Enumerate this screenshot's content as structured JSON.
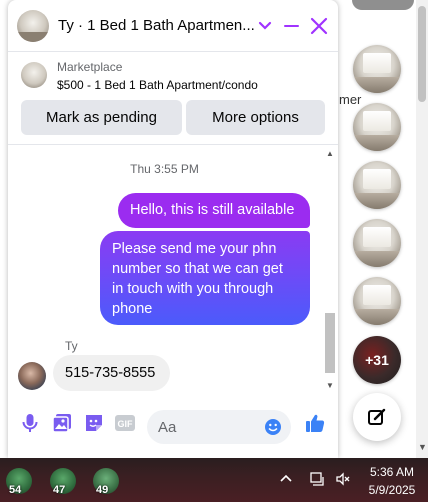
{
  "background": {
    "partial_text": "mer"
  },
  "chat_heads": {
    "more_count": "+31"
  },
  "chat": {
    "title": "Ty · 1 Bed 1 Bath Apartmen...",
    "marketplace": {
      "label": "Marketplace",
      "listing": "$500 - 1 Bed 1 Bath Apartment/condo",
      "pending_button": "Mark as pending",
      "more_button": "More options"
    },
    "thread": {
      "timestamp": "Thu 3:55 PM",
      "messages": [
        {
          "from": "me",
          "text": "Hello, this is still available"
        },
        {
          "from": "me",
          "text": "Please send me your phn number so that we can get in touch with you through phone"
        },
        {
          "from": "Ty",
          "text": "515-735-8555"
        }
      ],
      "sender_name": "Ty"
    },
    "composer": {
      "placeholder": "Aa"
    },
    "colors": {
      "accent": "#a033ff",
      "bubble_start": "#8a3bf3",
      "bubble_end": "#4b5bfb"
    }
  },
  "taskbar": {
    "items": [
      {
        "name": "app-1",
        "badge": "54"
      },
      {
        "name": "app-2",
        "badge": "47"
      },
      {
        "name": "app-3",
        "badge": "49"
      }
    ],
    "time": "5:36 AM",
    "date": "5/9/2025"
  }
}
